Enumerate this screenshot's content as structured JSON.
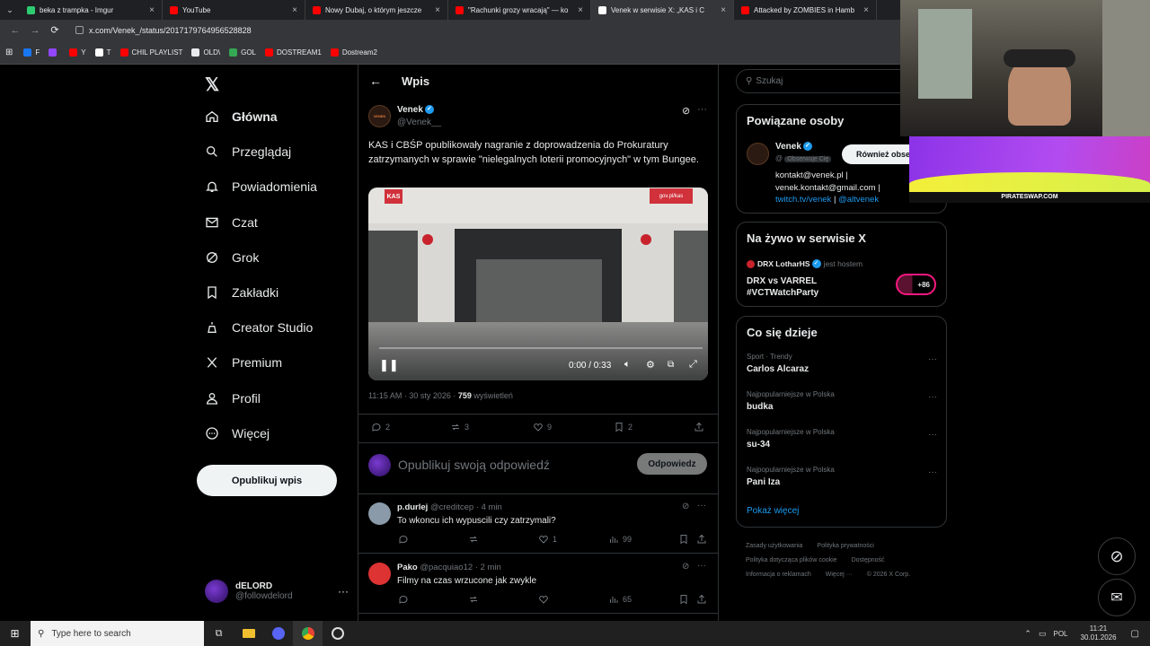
{
  "browser": {
    "tabs": [
      {
        "title": "beka z trampka - Imgur",
        "active": false,
        "color": "#2ecc71"
      },
      {
        "title": "YouTube",
        "active": false,
        "color": "#ff0000"
      },
      {
        "title": "Nowy Dubaj, o którym jeszcze",
        "active": false,
        "color": "#ff0000"
      },
      {
        "title": "\"Rachunki grozy wracają\" — ko",
        "active": false,
        "color": "#ff0000"
      },
      {
        "title": "Venek w serwisie X: „KAS i C",
        "active": true,
        "color": "#ffffff"
      },
      {
        "title": "Attacked by ZOMBIES in Hamb",
        "active": false,
        "color": "#ff0000"
      }
    ],
    "url": "x.com/Venek_/status/2017179764956528828",
    "bookmarks": [
      {
        "label": "F",
        "color": "#1877f2"
      },
      {
        "label": "",
        "color": "#9146ff"
      },
      {
        "label": "Y",
        "color": "#ff0000"
      },
      {
        "label": "T",
        "color": "#ffffff"
      },
      {
        "label": "CHIL PLAYLIST",
        "color": "#ff0000"
      },
      {
        "label": "OLD\\",
        "color": "#e8eaed"
      },
      {
        "label": "GOL",
        "color": "#34a853"
      },
      {
        "label": "DOSTREAM1",
        "color": "#ff0000"
      },
      {
        "label": "Dostream2",
        "color": "#ff0000"
      }
    ]
  },
  "nav": {
    "items": [
      "Główna",
      "Przeglądaj",
      "Powiadomienia",
      "Czat",
      "Grok",
      "Zakładki",
      "Creator Studio",
      "Premium",
      "Profil",
      "Więcej"
    ],
    "post_button": "Opublikuj wpis",
    "account": {
      "name": "dELORD",
      "handle": "@followdelord"
    }
  },
  "post": {
    "header": "Wpis",
    "author": "Venek",
    "handle": "@Venek__",
    "avatar_text": "VENEK",
    "text": "KAS i CBŚP opublikowały nagranie z doprowadzenia do Prokuratury zatrzymanych w sprawie \"nielegalnych loterii promocyjnych\" w tym Bungee.",
    "video": {
      "time": "0:00 / 0:33",
      "watermark": "gov.pl/kas",
      "logo": "KAS",
      "progress": 0.0
    },
    "meta_time": "11:15 AM · 30 sty 2026 · ",
    "views": "759",
    "views_label": " wyświetleń",
    "stats": {
      "replies": "2",
      "reposts": "3",
      "likes": "9",
      "bookmarks": "2"
    },
    "reply_placeholder": "Opublikuj swoją odpowiedź",
    "reply_button": "Odpowiedz"
  },
  "replies": [
    {
      "name": "p.durlej",
      "handle": "@creditcep",
      "time": "· 4 min",
      "text": "To wkoncu ich wypuscili czy zatrzymali?",
      "likes": "1",
      "views": "99"
    },
    {
      "name": "Pako",
      "handle": "@pacquiao12",
      "time": "· 2 min",
      "text": "Filmy na czas wrzucone jak zwykle",
      "likes": "",
      "views": "65"
    }
  ],
  "right": {
    "search_placeholder": "Szukaj",
    "related_title": "Powiązane osoby",
    "related": {
      "name": "Venek",
      "follows_badge": "Obserwuje Cię",
      "handle_prefix": "@",
      "follow_button": "Również obse",
      "bio_1": "kontakt@venek.pl |",
      "bio_2": "venek.kontakt@gmail.com |",
      "bio_3a": "twitch.tv/venek",
      "bio_3b": " | ",
      "bio_3c": "@altvenek"
    },
    "live_title": "Na żywo w serwisie X",
    "live": {
      "host": "DRX LotharHS",
      "hosting": "jest hostem",
      "title_1": "DRX vs VARREL",
      "title_2": "#VCTWatchParty",
      "count": "+86"
    },
    "trends_title": "Co się dzieje",
    "trends": [
      {
        "category": "Sport · Trendy",
        "name": "Carlos Alcaraz"
      },
      {
        "category": "Najpopularniejsze w Polska",
        "name": "budka"
      },
      {
        "category": "Najpopularniejsze w Polska",
        "name": "su-34"
      },
      {
        "category": "Najpopularniejsze w Polska",
        "name": "Pani Iza"
      }
    ],
    "show_more": "Pokaż więcej",
    "footer_1": [
      "Zasady użytkowania",
      "Polityka prywatności"
    ],
    "footer_2": [
      "Polityka dotycząca plików cookie",
      "Dostępność"
    ],
    "footer_3": [
      "Informacja o reklamach",
      "Więcej ···",
      "© 2026 X Corp."
    ]
  },
  "overlay": {
    "ad_text": "PIRATESWAP.COM"
  },
  "taskbar": {
    "search_placeholder": "Type here to search",
    "lang": "POL",
    "time": "11:21",
    "date": "30.01.2026"
  }
}
